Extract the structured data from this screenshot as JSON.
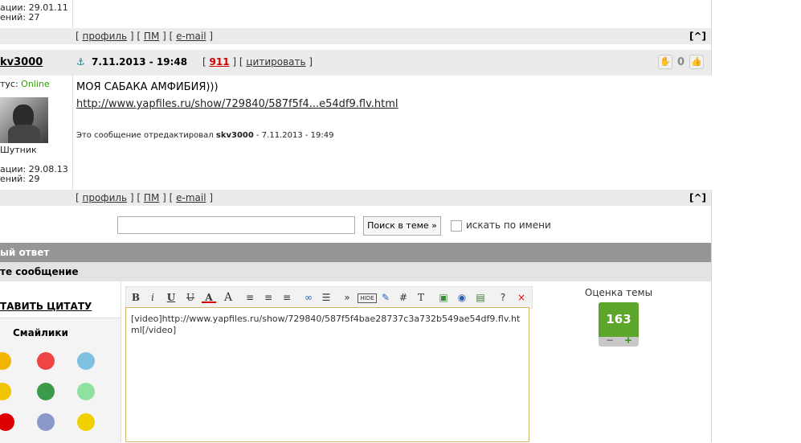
{
  "post_top": {
    "reg_label": "ации: 29.01.11",
    "posts_label": "ений: 27",
    "links": [
      "профиль",
      "ПМ",
      "e-mail"
    ],
    "top_btn": "[^]"
  },
  "post": {
    "author": "kv3000",
    "date": "7.11.2013 - 19:48",
    "number": "911",
    "quote": "цитировать",
    "status_label": "тус:",
    "status_value": "Online",
    "rank": "Шутник",
    "reg_label": "ации: 29.08.13",
    "posts_label": "ений: 29",
    "rating": "0",
    "text_line1": "МОЯ САБАКА АМФИБИЯ)))",
    "link": "http://www.yapfiles.ru/show/729840/587f5f4...e54df9.flv.html",
    "edited_prefix": "Это сообщение отредактировал",
    "edited_user": "skv3000",
    "edited_suffix": "- 7.11.2013 - 19:49",
    "links": [
      "профиль",
      "ПМ",
      "e-mail"
    ],
    "top_btn": "[^]"
  },
  "search": {
    "input_value": "",
    "button": "Поиск в теме »",
    "checkbox_label": "искать по имени"
  },
  "reply": {
    "header": "ый ответ",
    "subheader": "те сообщение",
    "insert_quote": "ТАВИТЬ ЦИТАТУ",
    "smilies_title": "Смайлики",
    "textarea": "[video]http://www.yapfiles.ru/show/729840/587f5f4bae28737c3a732b549ae54df9.flv.html[/video]",
    "rating_title": "Оценка темы",
    "rating_value": "163",
    "minus": "−",
    "plus": "+"
  },
  "colors": {
    "header_bar": "#969696",
    "sub_bar": "#e3e3e3",
    "rating_green": "#5ea62b",
    "online": "#2aa200",
    "number_red": "#d40000"
  }
}
